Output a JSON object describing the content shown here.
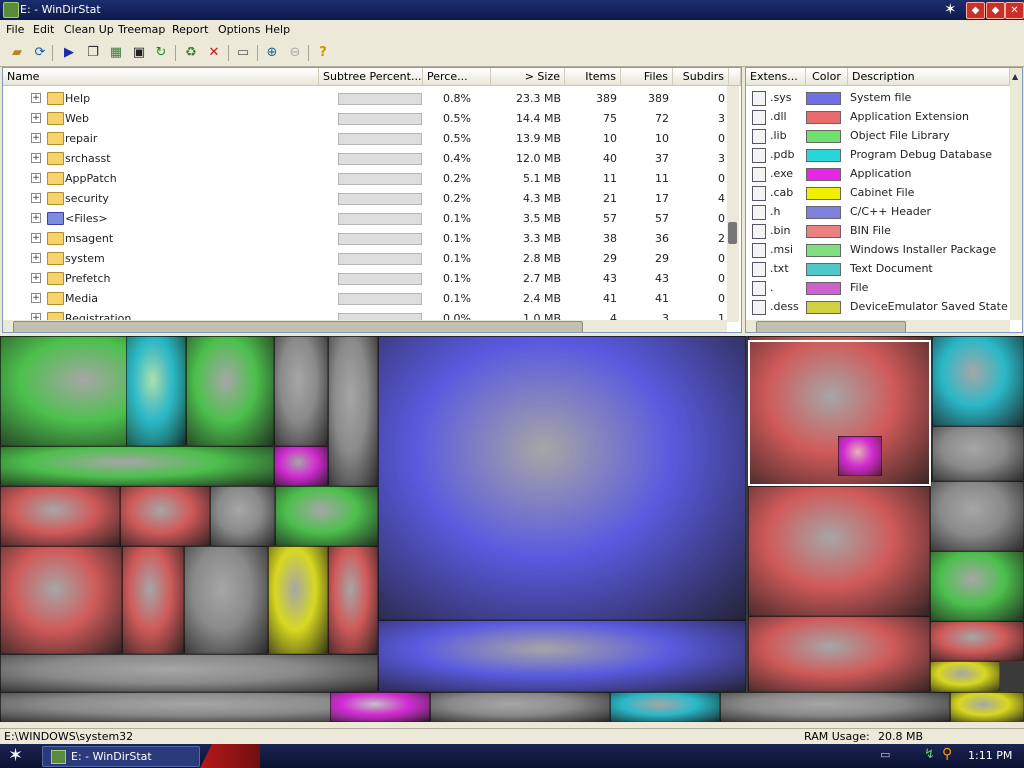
{
  "window": {
    "title": "E: - WinDirStat"
  },
  "menu": [
    "File",
    "Edit",
    "Clean Up",
    "Treemap",
    "Report",
    "Options",
    "Help"
  ],
  "toolbar_icons": [
    "open-icon",
    "refresh-icon",
    "play-icon",
    "copy-icon",
    "explorer-icon",
    "cmd-icon",
    "refresh-all-icon",
    "recycle-icon",
    "delete-icon",
    "properties-icon",
    "zoom-in-icon",
    "zoom-out-icon",
    "help-icon"
  ],
  "dir_table": {
    "columns": [
      "Name",
      "Subtree Percent...",
      "Perce...",
      "> Size",
      "Items",
      "Files",
      "Subdirs"
    ],
    "rows": [
      {
        "name": "Help",
        "pct": "0.8%",
        "size": "23.3 MB",
        "items": "389",
        "files": "389",
        "subdirs": "0",
        "type": "folder"
      },
      {
        "name": "Web",
        "pct": "0.5%",
        "size": "14.4 MB",
        "items": "75",
        "files": "72",
        "subdirs": "3",
        "type": "folder"
      },
      {
        "name": "repair",
        "pct": "0.5%",
        "size": "13.9 MB",
        "items": "10",
        "files": "10",
        "subdirs": "0",
        "type": "folder"
      },
      {
        "name": "srchasst",
        "pct": "0.4%",
        "size": "12.0 MB",
        "items": "40",
        "files": "37",
        "subdirs": "3",
        "type": "folder"
      },
      {
        "name": "AppPatch",
        "pct": "0.2%",
        "size": "5.1 MB",
        "items": "11",
        "files": "11",
        "subdirs": "0",
        "type": "folder"
      },
      {
        "name": "security",
        "pct": "0.2%",
        "size": "4.3 MB",
        "items": "21",
        "files": "17",
        "subdirs": "4",
        "type": "folder"
      },
      {
        "name": "<Files>",
        "pct": "0.1%",
        "size": "3.5 MB",
        "items": "57",
        "files": "57",
        "subdirs": "0",
        "type": "files"
      },
      {
        "name": "msagent",
        "pct": "0.1%",
        "size": "3.3 MB",
        "items": "38",
        "files": "36",
        "subdirs": "2",
        "type": "folder"
      },
      {
        "name": "system",
        "pct": "0.1%",
        "size": "2.8 MB",
        "items": "29",
        "files": "29",
        "subdirs": "0",
        "type": "folder"
      },
      {
        "name": "Prefetch",
        "pct": "0.1%",
        "size": "2.7 MB",
        "items": "43",
        "files": "43",
        "subdirs": "0",
        "type": "folder"
      },
      {
        "name": "Media",
        "pct": "0.1%",
        "size": "2.4 MB",
        "items": "41",
        "files": "41",
        "subdirs": "0",
        "type": "folder"
      },
      {
        "name": "Registration",
        "pct": "0.0%",
        "size": "1.0 MB",
        "items": "4",
        "files": "3",
        "subdirs": "1",
        "type": "folder"
      }
    ]
  },
  "ext_table": {
    "columns": [
      "Extens...",
      "Color",
      "Description"
    ],
    "rows": [
      {
        "ext": ".sys",
        "color": "#6f6fe6",
        "desc": "System file"
      },
      {
        "ext": ".dll",
        "color": "#e86a6a",
        "desc": "Application Extension"
      },
      {
        "ext": ".lib",
        "color": "#6ee06e",
        "desc": "Object File Library"
      },
      {
        "ext": ".pdb",
        "color": "#28d8d8",
        "desc": "Program Debug Database"
      },
      {
        "ext": ".exe",
        "color": "#e626e6",
        "desc": "Application"
      },
      {
        "ext": ".cab",
        "color": "#f0f000",
        "desc": "Cabinet File"
      },
      {
        "ext": ".h",
        "color": "#8080e0",
        "desc": "C/C++ Header"
      },
      {
        "ext": ".bin",
        "color": "#ea8080",
        "desc": "BIN File"
      },
      {
        "ext": ".msi",
        "color": "#80e080",
        "desc": "Windows Installer Package"
      },
      {
        "ext": ".txt",
        "color": "#50c8c8",
        "desc": "Text Document"
      },
      {
        "ext": ".",
        "color": "#d060d0",
        "desc": "File"
      },
      {
        "ext": ".dess",
        "color": "#d0d040",
        "desc": "DeviceEmulator Saved State File"
      }
    ]
  },
  "status": {
    "path": "E:\\WINDOWS\\system32",
    "ram_label": "RAM Usage:",
    "ram_value": "20.8 MB"
  },
  "taskbar": {
    "task_label": "E: - WinDirStat",
    "clock": "1:11 PM"
  }
}
